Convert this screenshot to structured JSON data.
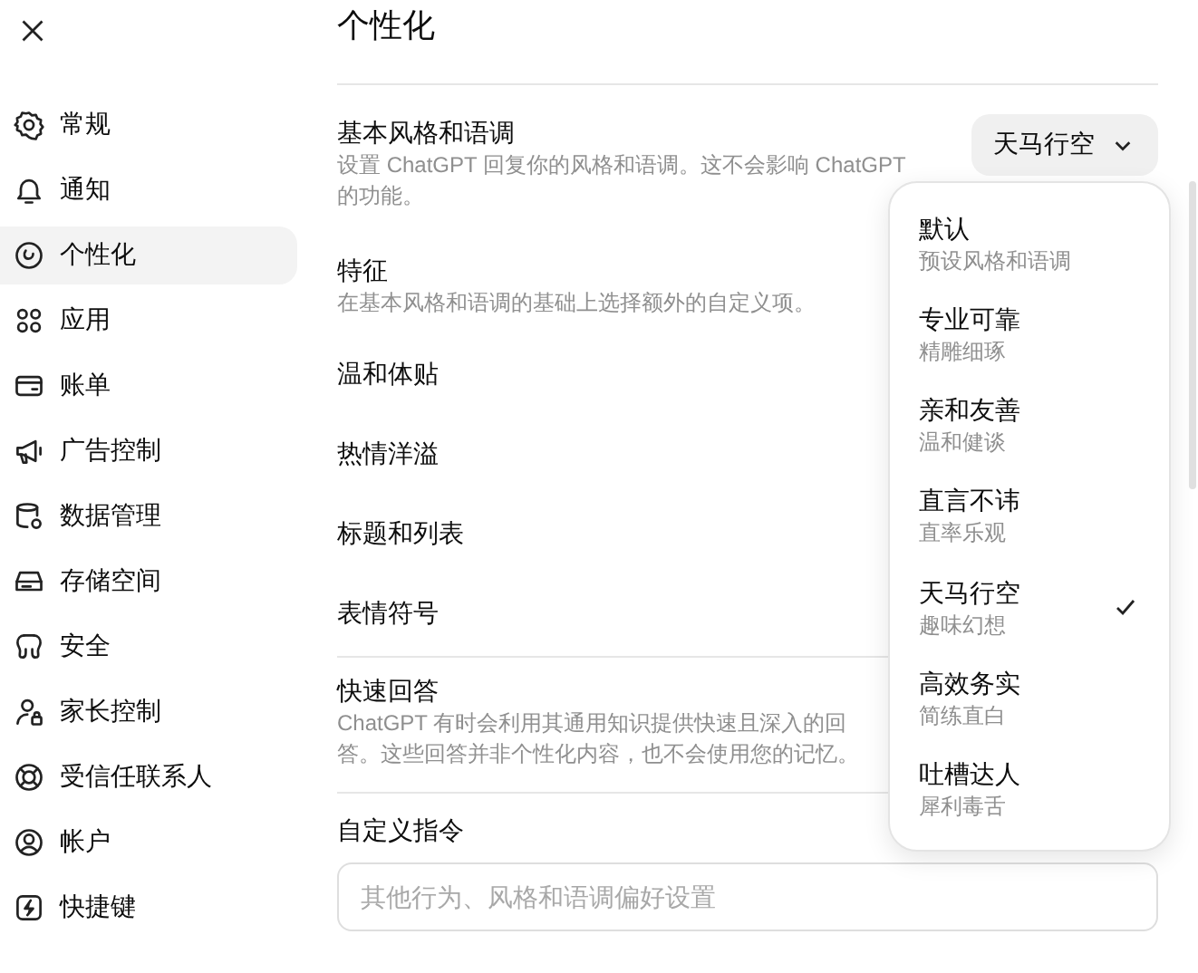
{
  "sidebar": {
    "items": [
      {
        "label": "常规",
        "selected": false
      },
      {
        "label": "通知",
        "selected": false
      },
      {
        "label": "个性化",
        "selected": true
      },
      {
        "label": "应用",
        "selected": false
      },
      {
        "label": "账单",
        "selected": false
      },
      {
        "label": "广告控制",
        "selected": false
      },
      {
        "label": "数据管理",
        "selected": false
      },
      {
        "label": "存储空间",
        "selected": false
      },
      {
        "label": "安全",
        "selected": false
      },
      {
        "label": "家长控制",
        "selected": false
      },
      {
        "label": "受信任联系人",
        "selected": false
      },
      {
        "label": "帐户",
        "selected": false
      },
      {
        "label": "快捷键",
        "selected": false
      }
    ]
  },
  "page": {
    "title": "个性化"
  },
  "base_style": {
    "label": "基本风格和语调",
    "description": "设置 ChatGPT 回复你的风格和语调。这不会影响 ChatGPT 的功能。",
    "select_value": "天马行空"
  },
  "traits": {
    "label": "特征",
    "description": "在基本风格和语调的基础上选择额外的自定义项。",
    "items": [
      "温和体贴",
      "热情洋溢",
      "标题和列表",
      "表情符号"
    ]
  },
  "quick_answers": {
    "label": "快速回答",
    "description": "ChatGPT 有时会利用其通用知识提供快速且深入的回答。这些回答并非个性化内容，也不会使用您的记忆。"
  },
  "custom_instructions": {
    "label": "自定义指令",
    "placeholder": "其他行为、风格和语调偏好设置"
  },
  "dropdown": {
    "items": [
      {
        "label": "默认",
        "sublabel": "预设风格和语调",
        "selected": false
      },
      {
        "label": "专业可靠",
        "sublabel": "精雕细琢",
        "selected": false
      },
      {
        "label": "亲和友善",
        "sublabel": "温和健谈",
        "selected": false
      },
      {
        "label": "直言不讳",
        "sublabel": "直率乐观",
        "selected": false
      },
      {
        "label": "天马行空",
        "sublabel": "趣味幻想",
        "selected": true
      },
      {
        "label": "高效务实",
        "sublabel": "简练直白",
        "selected": false
      },
      {
        "label": "吐槽达人",
        "sublabel": "犀利毒舌",
        "selected": false
      }
    ]
  }
}
